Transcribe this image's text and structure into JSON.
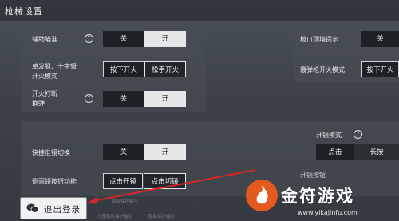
{
  "header": {
    "title": "枪械设置"
  },
  "settings": {
    "aim_assist": {
      "label": "辅助瞄准",
      "off": "关",
      "on": "开"
    },
    "muzzle_hint": {
      "label": "枪口顶墙提示",
      "off": "关",
      "on": "开"
    },
    "fire_mode_single": {
      "label_line1": "单发狙、十字弩",
      "label_line2": "开火模式",
      "press": "按下开火",
      "release": "松手开火"
    },
    "shotgun_fire": {
      "label": "霰弹枪开火模式",
      "press": "按下开火"
    },
    "interrupt_reload": {
      "label_line1": "开火打断",
      "label_line2": "换弹",
      "off": "关",
      "on": "开"
    },
    "scope_mode": {
      "label": "开镜模式",
      "tap": "点击",
      "hold": "长按"
    },
    "quick_scope": {
      "label": "快捷准镜切换",
      "off": "关",
      "on": "开"
    },
    "side_scope": {
      "label": "侧面镜按钮功能",
      "tap_open": "点击开镜",
      "tap_switch": "点击切镜"
    },
    "scope_switch_partial": {
      "label": "开镜按钮"
    }
  },
  "footer": {
    "logout_label": "退出登录",
    "faint_line1": "隐私保护指引",
    "faint_line2": "儿童隐私保护指引",
    "faint_line3": "隐私保护指引"
  },
  "watermark": {
    "brand": "金符游戏",
    "url": "www.yikajinfu.com"
  },
  "colors": {
    "accent_on": "#e6e7e9",
    "segment_off": "#1d2126",
    "watermark_orange": "#e45a1e",
    "arrow_red": "#d7262b"
  },
  "icons": {
    "help": "help-circle-icon",
    "logout": "chat-bubble-icon",
    "watermark_logo": "flame-logo-icon"
  }
}
